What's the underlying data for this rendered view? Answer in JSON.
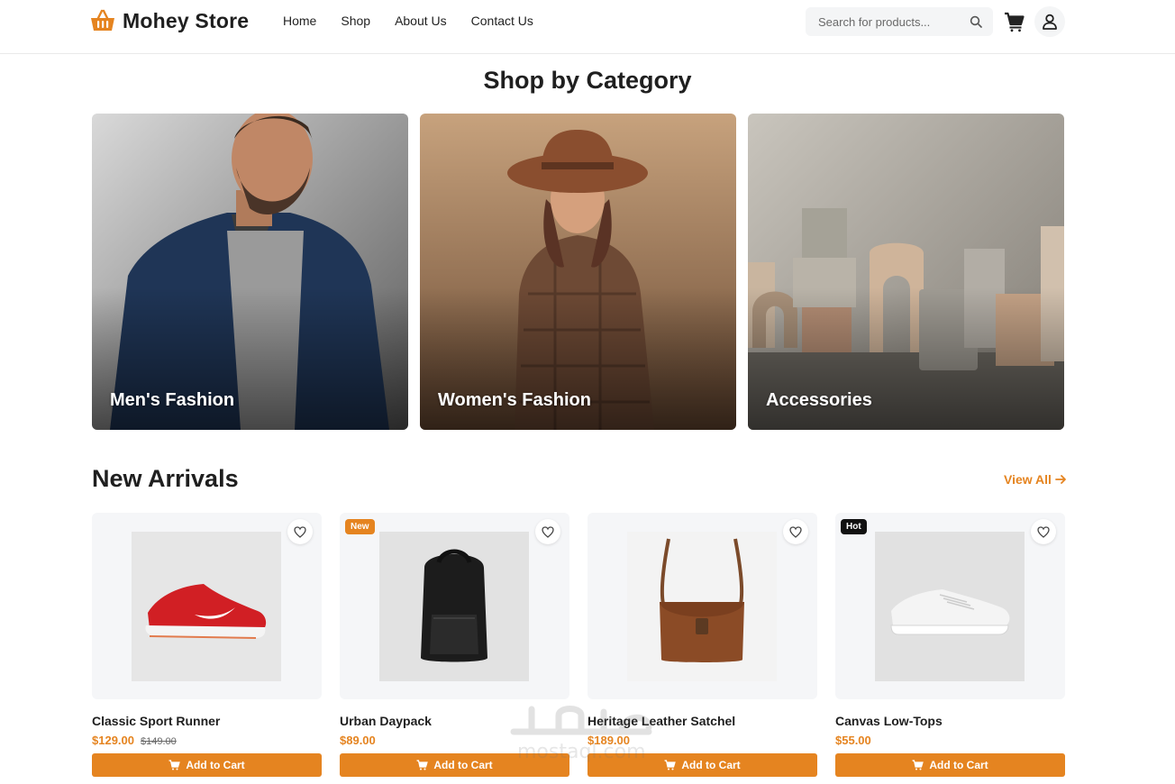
{
  "brand": {
    "name": "Mohey Store"
  },
  "nav": {
    "items": [
      "Home",
      "Shop",
      "About Us",
      "Contact Us"
    ]
  },
  "search": {
    "placeholder": "Search for products..."
  },
  "categories": {
    "title": "Shop by Category",
    "items": [
      {
        "label": "Men's Fashion"
      },
      {
        "label": "Women's Fashion"
      },
      {
        "label": "Accessories"
      }
    ]
  },
  "arrivals": {
    "title": "New Arrivals",
    "view_all": "View All",
    "products": [
      {
        "name": "Classic Sport Runner",
        "price": "$129.00",
        "old_price": "$149.00",
        "badge": "",
        "button": "Add to Cart"
      },
      {
        "name": "Urban Daypack",
        "price": "$89.00",
        "old_price": "",
        "badge": "New",
        "button": "Add to Cart"
      },
      {
        "name": "Heritage Leather Satchel",
        "price": "$189.00",
        "old_price": "",
        "badge": "",
        "button": "Add to Cart"
      },
      {
        "name": "Canvas Low-Tops",
        "price": "$55.00",
        "old_price": "",
        "badge": "Hot",
        "button": "Add to Cart"
      }
    ]
  },
  "watermark": {
    "text": "mostaql.com"
  },
  "colors": {
    "accent": "#e58420",
    "text": "#1f1f1f",
    "hot_badge": "#111111",
    "card_bg": "#f5f6f8"
  },
  "icons": [
    "basket-logo-icon",
    "search-icon",
    "cart-icon",
    "user-icon",
    "heart-icon",
    "arrow-right-icon",
    "cart-small-icon"
  ]
}
